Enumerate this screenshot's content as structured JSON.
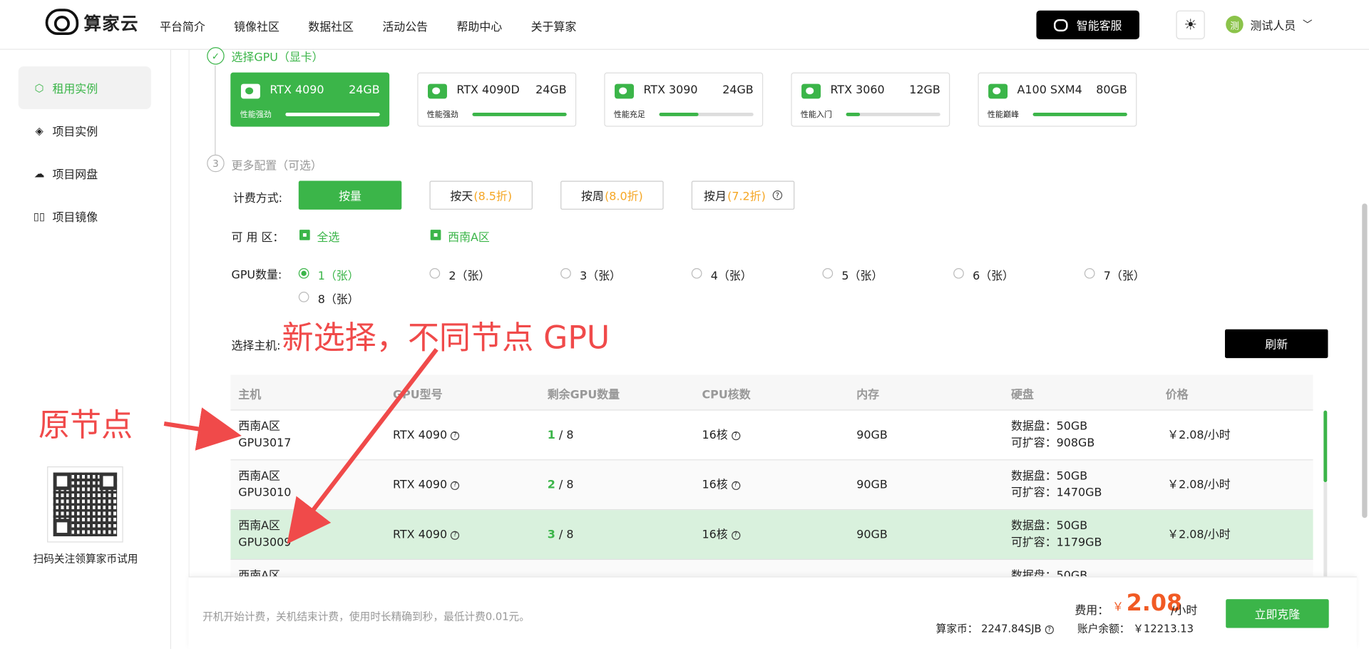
{
  "header": {
    "logo_text": "算家云",
    "nav": [
      "平台简介",
      "镜像社区",
      "数据社区",
      "活动公告",
      "帮助中心",
      "关于算家"
    ],
    "service_button": "智能客服",
    "user_avatar": "测",
    "user_name": "测试人员"
  },
  "sidebar": {
    "items": [
      {
        "label": "租用实例",
        "icon": "cube-icon",
        "active": true
      },
      {
        "label": "项目实例",
        "icon": "layers-icon",
        "active": false
      },
      {
        "label": "项目网盘",
        "icon": "cloud-disk-icon",
        "active": false
      },
      {
        "label": "项目镜像",
        "icon": "mirror-icon",
        "active": false
      }
    ],
    "qr_caption": "扫码关注领算家币试用"
  },
  "steps": {
    "gpu_title": "选择GPU（显卡）",
    "more_number": "3",
    "more_title": "更多配置（可选）"
  },
  "gpu_cards": [
    {
      "name": "RTX 4090",
      "mem": "24GB",
      "perf": "性能强劲",
      "level": 1.0,
      "selected": true
    },
    {
      "name": "RTX 4090D",
      "mem": "24GB",
      "perf": "性能强劲",
      "level": 1.0,
      "selected": false
    },
    {
      "name": "RTX 3090",
      "mem": "24GB",
      "perf": "性能充足",
      "level": 0.42,
      "selected": false
    },
    {
      "name": "RTX 3060",
      "mem": "12GB",
      "perf": "性能入门",
      "level": 0.15,
      "selected": false
    },
    {
      "name": "A100 SXM4",
      "mem": "80GB",
      "perf": "性能巅峰",
      "level": 1.0,
      "selected": false
    }
  ],
  "billing": {
    "label": "计费方式:",
    "options": [
      {
        "text": "按量",
        "discount": ""
      },
      {
        "text": "按天",
        "discount": "(8.5折)"
      },
      {
        "text": "按周",
        "discount": "(8.0折)"
      },
      {
        "text": "按月",
        "discount": "(7.2折)"
      }
    ]
  },
  "zone": {
    "label": "可 用 区：",
    "all": "全选",
    "region": "西南A区"
  },
  "gpu_count": {
    "label": "GPU数量:",
    "options": [
      "1（张）",
      "2（张）",
      "3（张）",
      "4（张）",
      "5（张）",
      "6（张）",
      "7（张）",
      "8（张）"
    ]
  },
  "host": {
    "label": "选择主机:",
    "refresh": "刷新",
    "columns": [
      "主机",
      "GPU型号",
      "剩余GPU数量",
      "CPU核数",
      "内存",
      "硬盘",
      "价格"
    ],
    "rows": [
      {
        "zone": "西南A区",
        "host": "GPU3017",
        "gpu": "RTX 4090",
        "free": "1",
        "total": "/ 8",
        "cpu": "16核",
        "mem": "90GB",
        "disk": "数据盘：50GB",
        "expand": "可扩容：908GB",
        "price": "￥2.08/小时"
      },
      {
        "zone": "西南A区",
        "host": "GPU3010",
        "gpu": "RTX 4090",
        "free": "2",
        "total": "/ 8",
        "cpu": "16核",
        "mem": "90GB",
        "disk": "数据盘：50GB",
        "expand": "可扩容：1470GB",
        "price": "￥2.08/小时"
      },
      {
        "zone": "西南A区",
        "host": "GPU3009",
        "gpu": "RTX 4090",
        "free": "3",
        "total": "/ 8",
        "cpu": "16核",
        "mem": "90GB",
        "disk": "数据盘：50GB",
        "expand": "可扩容：1179GB",
        "price": "￥2.08/小时"
      },
      {
        "zone": "西南A区",
        "host": "",
        "gpu": "",
        "free": "",
        "total": "",
        "cpu": "",
        "mem": "",
        "disk": "数据盘：50GB",
        "expand": "",
        "price": ""
      }
    ]
  },
  "footer": {
    "note": "开机开始计费，关机结束计费，使用时长精确到秒，最低计费0.01元。",
    "fee_label": "费用：",
    "currency": "￥",
    "fee_value": "2.08",
    "fee_unit": "/小时",
    "coin": "算家币：  2247.84SJB",
    "balance": "账户余额：  ￥12213.13",
    "clone_button": "立即克隆"
  },
  "annotations": {
    "new_choice": "新选择，不同节点 GPU",
    "original": "原节点"
  },
  "colors": {
    "accent": "#3bb549",
    "annotation": "#f04a4a",
    "price": "#f15a24"
  }
}
